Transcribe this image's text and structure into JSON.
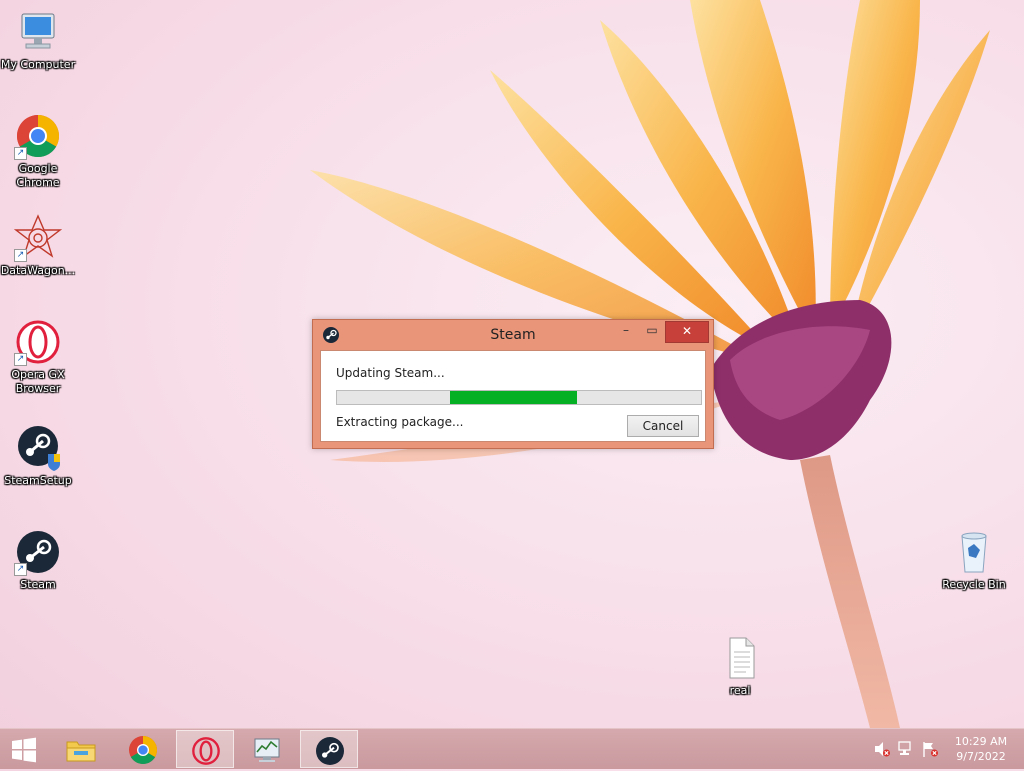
{
  "desktop": {
    "icons": [
      {
        "label": "My Computer"
      },
      {
        "label": "Google Chrome"
      },
      {
        "label": "DataWagon..."
      },
      {
        "label": "Opera GX Browser"
      },
      {
        "label": "SteamSetup"
      },
      {
        "label": "Steam"
      },
      {
        "label": "Recycle Bin"
      },
      {
        "label": "real"
      }
    ]
  },
  "dialog": {
    "title": "Steam",
    "status_line": "Updating Steam...",
    "detail_line": "Extracting package...",
    "cancel_label": "Cancel",
    "progress": {
      "start": 0.31,
      "end": 0.66
    }
  },
  "taskbar": {
    "items": [
      "start-button",
      "file-explorer",
      "google-chrome",
      "opera-gx",
      "resource-monitor",
      "steam"
    ],
    "clock": {
      "time": "10:29 AM",
      "date": "9/7/2022"
    }
  },
  "colors": {
    "dialog_frame": "#e8957a",
    "progress_fill": "#06b025",
    "close_button": "#c7413a",
    "taskbar": "#c9999e"
  }
}
